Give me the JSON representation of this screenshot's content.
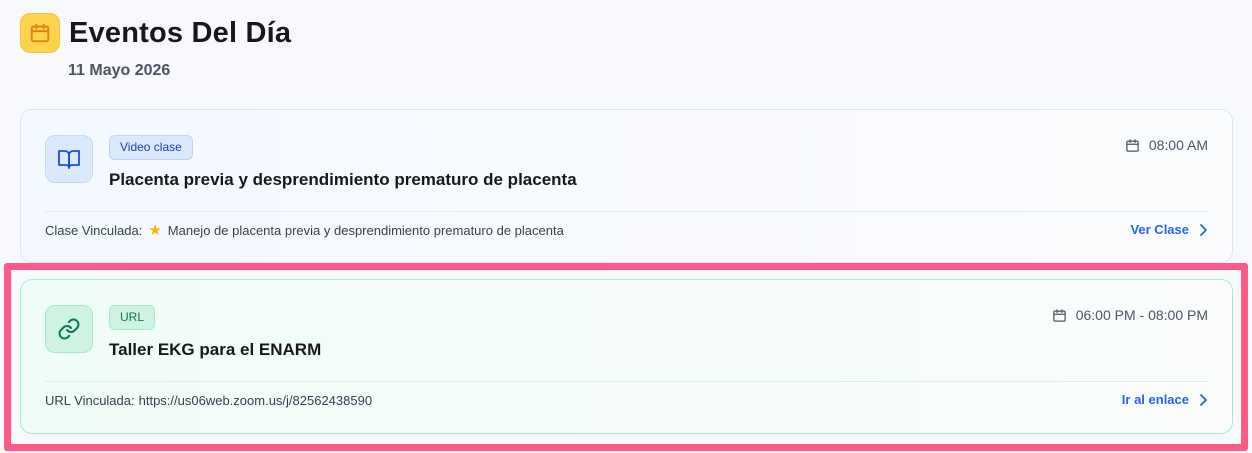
{
  "header": {
    "title": "Eventos Del Día",
    "date": "11 Mayo 2026",
    "icon": "calendar-icon",
    "accent": "#fcd34d"
  },
  "events": [
    {
      "tag": "Video clase",
      "icon": "book-open-icon",
      "title": "Placenta previa y desprendimiento prematuro de placenta",
      "time": "08:00 AM",
      "linked_label": "Clase Vinculada:",
      "linked_icon": "star-icon",
      "linked_value": "Manejo de placenta previa y desprendimiento prematuro de placenta",
      "action_label": "Ver Clase",
      "color": "#2563eb"
    },
    {
      "tag": "URL",
      "icon": "link-icon",
      "title": "Taller EKG para el ENARM",
      "time": "06:00 PM - 08:00 PM",
      "linked_label": "URL Vinculada:",
      "linked_value": "https://us06web.zoom.us/j/82562438590",
      "action_label": "Ir al enlace",
      "color": "#059669",
      "highlighted": true
    }
  ]
}
